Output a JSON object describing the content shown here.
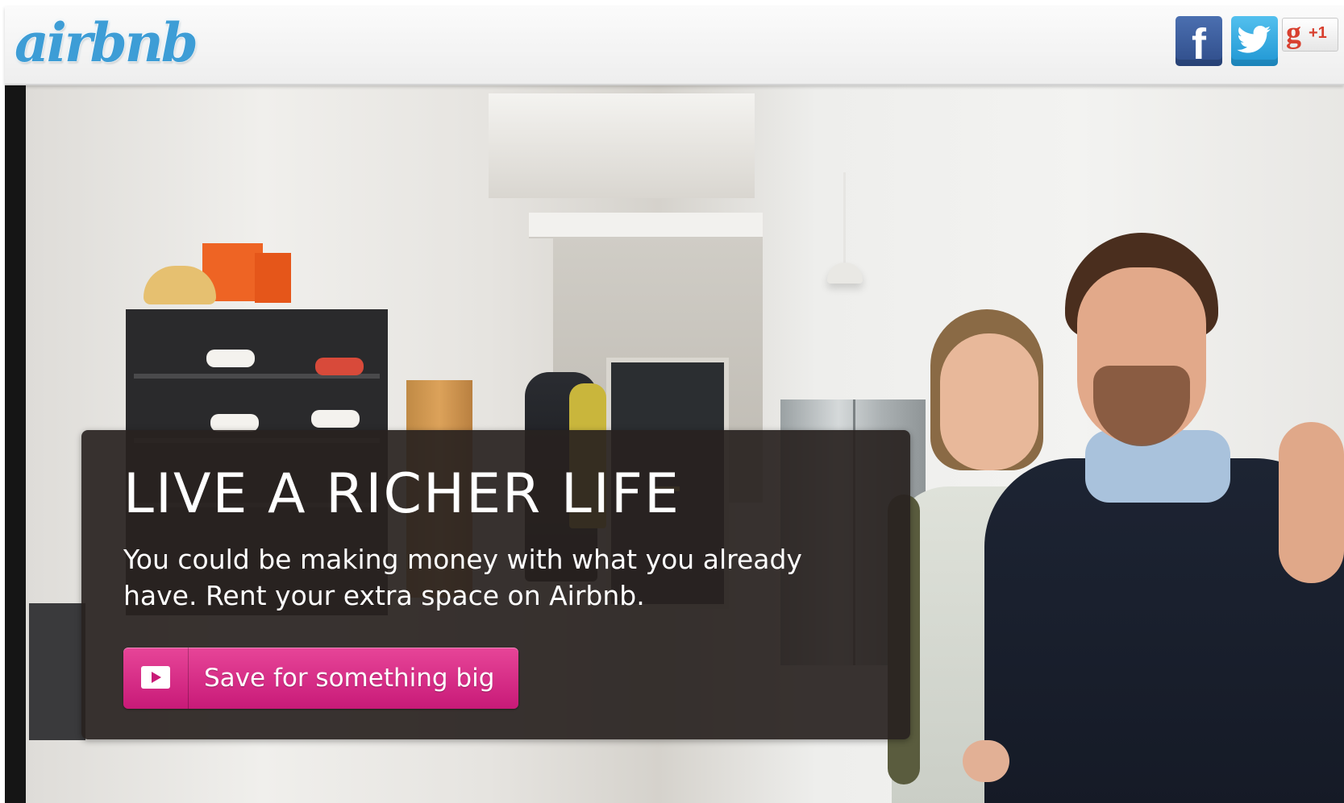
{
  "header": {
    "logo_text": "airbnb",
    "social": {
      "facebook_glyph": "f",
      "google_glyph": "g",
      "google_count": "+1",
      "icons": [
        "facebook-icon",
        "twitter-icon",
        "google-plus-icon"
      ]
    }
  },
  "hero": {
    "title": "LIVE A RICHER LIFE",
    "text": "You could be making money with what you already have. Rent your extra space on Airbnb.",
    "cta_label": "Save for something big",
    "cta_icon": "play-video-icon"
  },
  "colors": {
    "brand_blue": "#3d9dd6",
    "cta_pink": "#e1308a",
    "card_bg": "#282220",
    "facebook": "#3b5998",
    "twitter": "#33b5e8",
    "google_red": "#d8402f"
  }
}
